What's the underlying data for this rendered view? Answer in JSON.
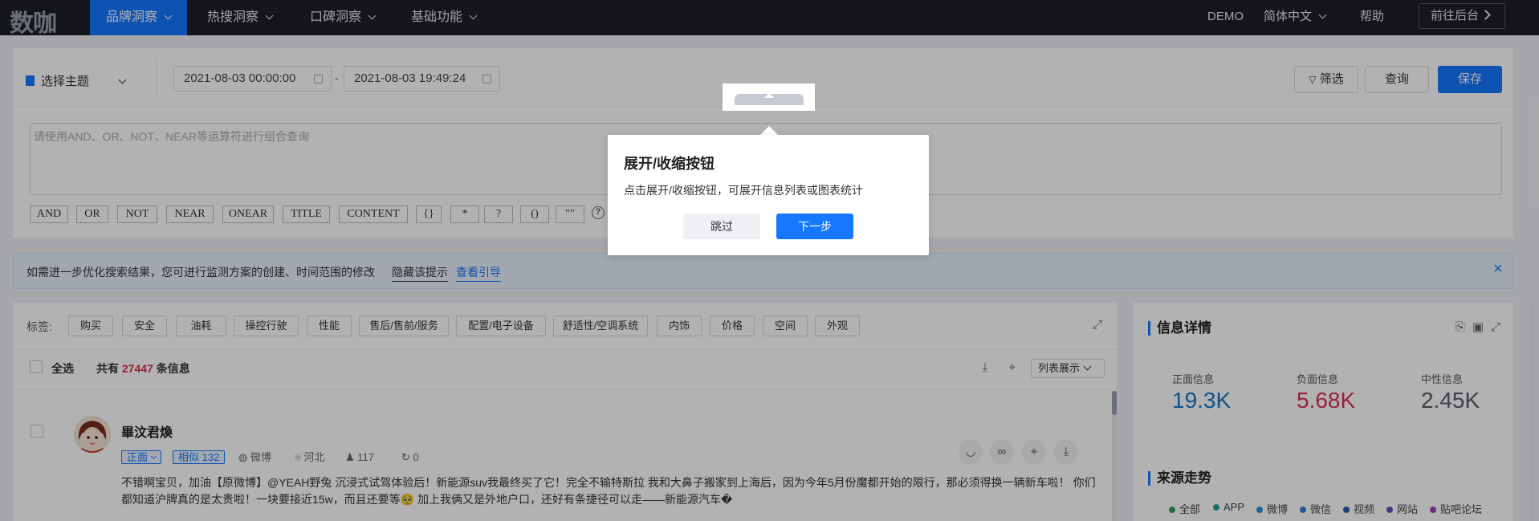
{
  "app": {
    "logo": "数咖"
  },
  "nav": {
    "items": [
      {
        "label": "品牌洞察"
      },
      {
        "label": "热搜洞察"
      },
      {
        "label": "口碑洞察"
      },
      {
        "label": "基础功能"
      }
    ],
    "demo": "DEMO",
    "language": "简体中文",
    "help": "帮助",
    "backend": "前往后台"
  },
  "query": {
    "theme": "选择主题",
    "start_date": "2021-08-03 00:00:00",
    "date_sep": "-",
    "end_date": "2021-08-03 19:49:24",
    "filter": "筛选",
    "search": "查询",
    "save": "保存",
    "placeholder": "请使用AND、OR、NOT、NEAR等运算符进行组合查询",
    "operators": [
      "AND",
      "OR",
      "NOT",
      "NEAR",
      "ONEAR",
      "TITLE",
      "CONTENT",
      "{}",
      "*",
      "?",
      "()",
      "\"\""
    ],
    "help_mark": "?"
  },
  "tip": {
    "text": "如需进一步优化搜索结果，您可进行监测方案的创建、时间范围的修改",
    "hide": "隐藏该提示",
    "guide": "查看引导",
    "close": "×"
  },
  "tags": {
    "label": "标签:",
    "items": [
      "购买",
      "安全",
      "油耗",
      "操控行驶",
      "性能",
      "售后/售前/服务",
      "配置/电子设备",
      "舒适性/空调系统",
      "内饰",
      "价格",
      "空间",
      "外观"
    ]
  },
  "list": {
    "select_all": "全选",
    "count_prefix": "共有",
    "count": "27447",
    "count_suffix": "条信息",
    "view_mode": "列表展示"
  },
  "post": {
    "author": "畢汶君煥",
    "sentiment": "正面",
    "similar": "相似 132",
    "platform": "微博",
    "location": "河北",
    "followers": "117",
    "reposts": "0",
    "content": "不错啊宝贝，加油【原微博】@YEAH野兔 沉浸式试驾体验后！新能源suv我最终买了它！完全不输特斯拉 我和大鼻子搬家到上海后，因为今年5月份魔都开始的限行，那必须得换一辆新车啦！ 你们都知道沪牌真的是太贵啦！一块要接近15w，而且还要等🥺 加上我俩又是外地户口，还好有条捷径可以走——新能源汽车�"
  },
  "side": {
    "info_title": "信息详情",
    "stats": [
      {
        "label": "正面信息",
        "value": "19.3K",
        "color": "#1677c6"
      },
      {
        "label": "负面信息",
        "value": "5.68K",
        "color": "#d9304f"
      },
      {
        "label": "中性信息",
        "value": "2.45K",
        "color": "#555b66"
      }
    ],
    "trend_title": "来源走势",
    "legend": [
      {
        "label": "全部",
        "color": "#2e9e57"
      },
      {
        "label": "APP",
        "color": "#2aa198"
      },
      {
        "label": "微博",
        "color": "#2d8fd5"
      },
      {
        "label": "微信",
        "color": "#3a7bd5"
      },
      {
        "label": "视频",
        "color": "#2f5aa8"
      },
      {
        "label": "网站",
        "color": "#6a4bb5"
      },
      {
        "label": "贴吧论坛",
        "color": "#9b3fb8"
      }
    ]
  },
  "tour": {
    "title": "展开/收缩按钮",
    "desc": "点击展开/收缩按钮，可展开信息列表或图表统计",
    "skip": "跳过",
    "next": "下一步"
  }
}
